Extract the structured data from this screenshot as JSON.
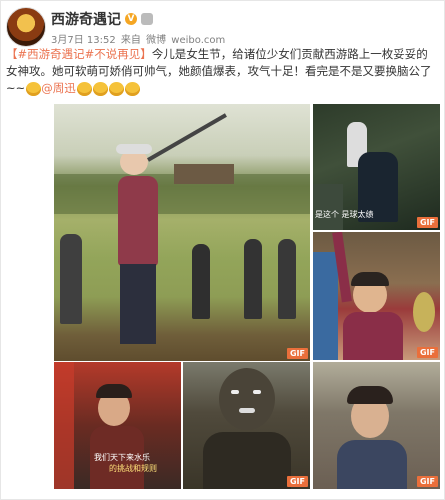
{
  "post": {
    "username": "西游奇遇记",
    "meta": {
      "date": "3月7日 13:52",
      "source_prefix": "来自",
      "source": "微博",
      "domain": "weibo.com"
    },
    "topic": "【#西游奇遇记#不说再见】",
    "text_main": "今儿是女生节，给诸位少女们贡献西游路上一枚妥妥的女神攻。她可软萌可娇俏可帅气，她颜值爆表，攻气十足！看完是不是又要换脑公了~~",
    "mention": "@周迅",
    "gif_label": "GIF",
    "captions": {
      "p2": "是这个 是球太绩",
      "p4_line1": "我们天下来水乐",
      "p4_line2": "的挑战和规则"
    }
  },
  "colors": {
    "accent": "#eb7350",
    "gif_badge": "#ea6f3b",
    "verified": "#f5a623"
  },
  "icons": [
    "verified-badge-icon",
    "member-icon",
    "emoji-icon"
  ]
}
